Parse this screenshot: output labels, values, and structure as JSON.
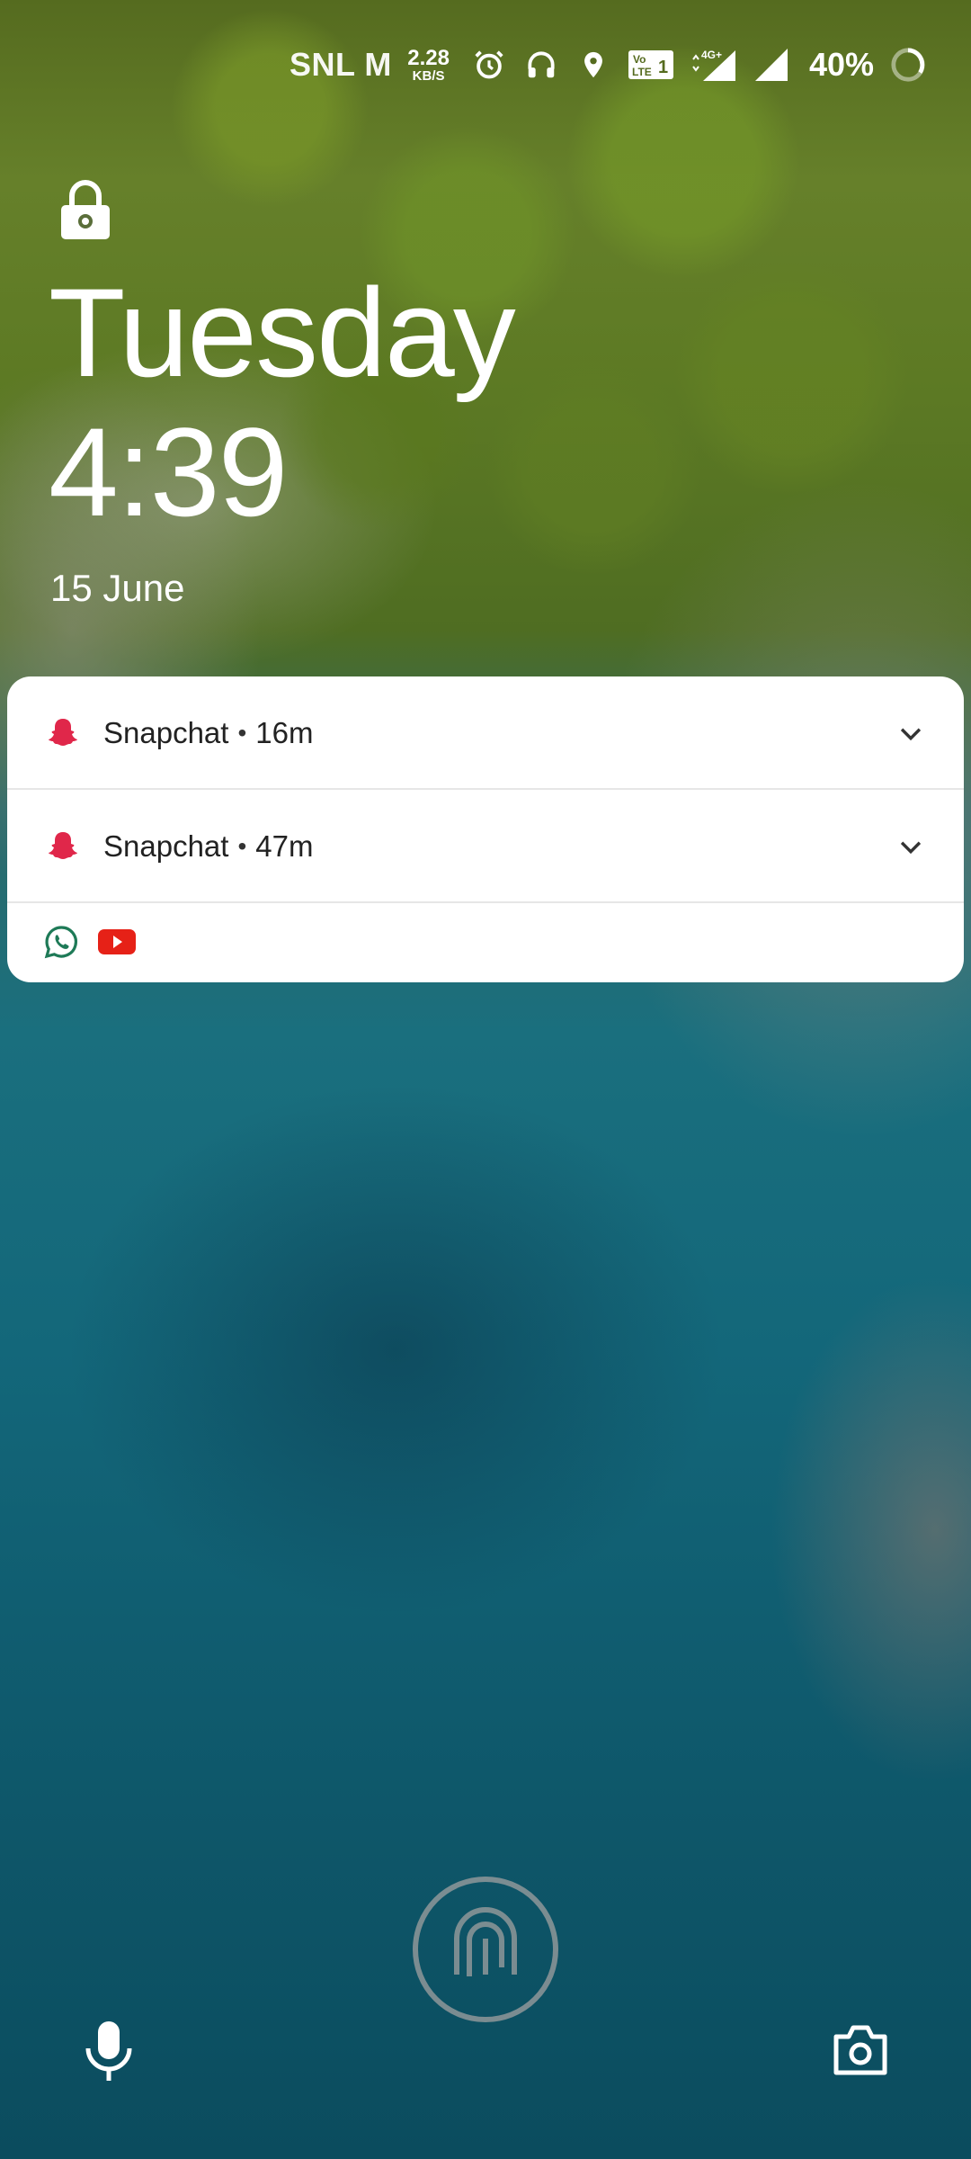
{
  "status_bar": {
    "carrier": "SNL M",
    "network_speed_value": "2.28",
    "network_speed_unit": "KB/S",
    "signal_tag": "4G+",
    "volte_tag": "Vo LTE 1",
    "battery_text": "40%"
  },
  "lockscreen": {
    "day": "Tuesday",
    "time": "4:39",
    "date": "15 June"
  },
  "notifications": [
    {
      "app": "Snapchat",
      "separator": "•",
      "age": "16m"
    },
    {
      "app": "Snapchat",
      "separator": "•",
      "age": "47m"
    }
  ],
  "overflow_icons": [
    "whatsapp-icon",
    "youtube-icon"
  ],
  "colors": {
    "snapchat": "#e0274a",
    "whatsapp": "#1e7a57",
    "youtube": "#e62117"
  }
}
